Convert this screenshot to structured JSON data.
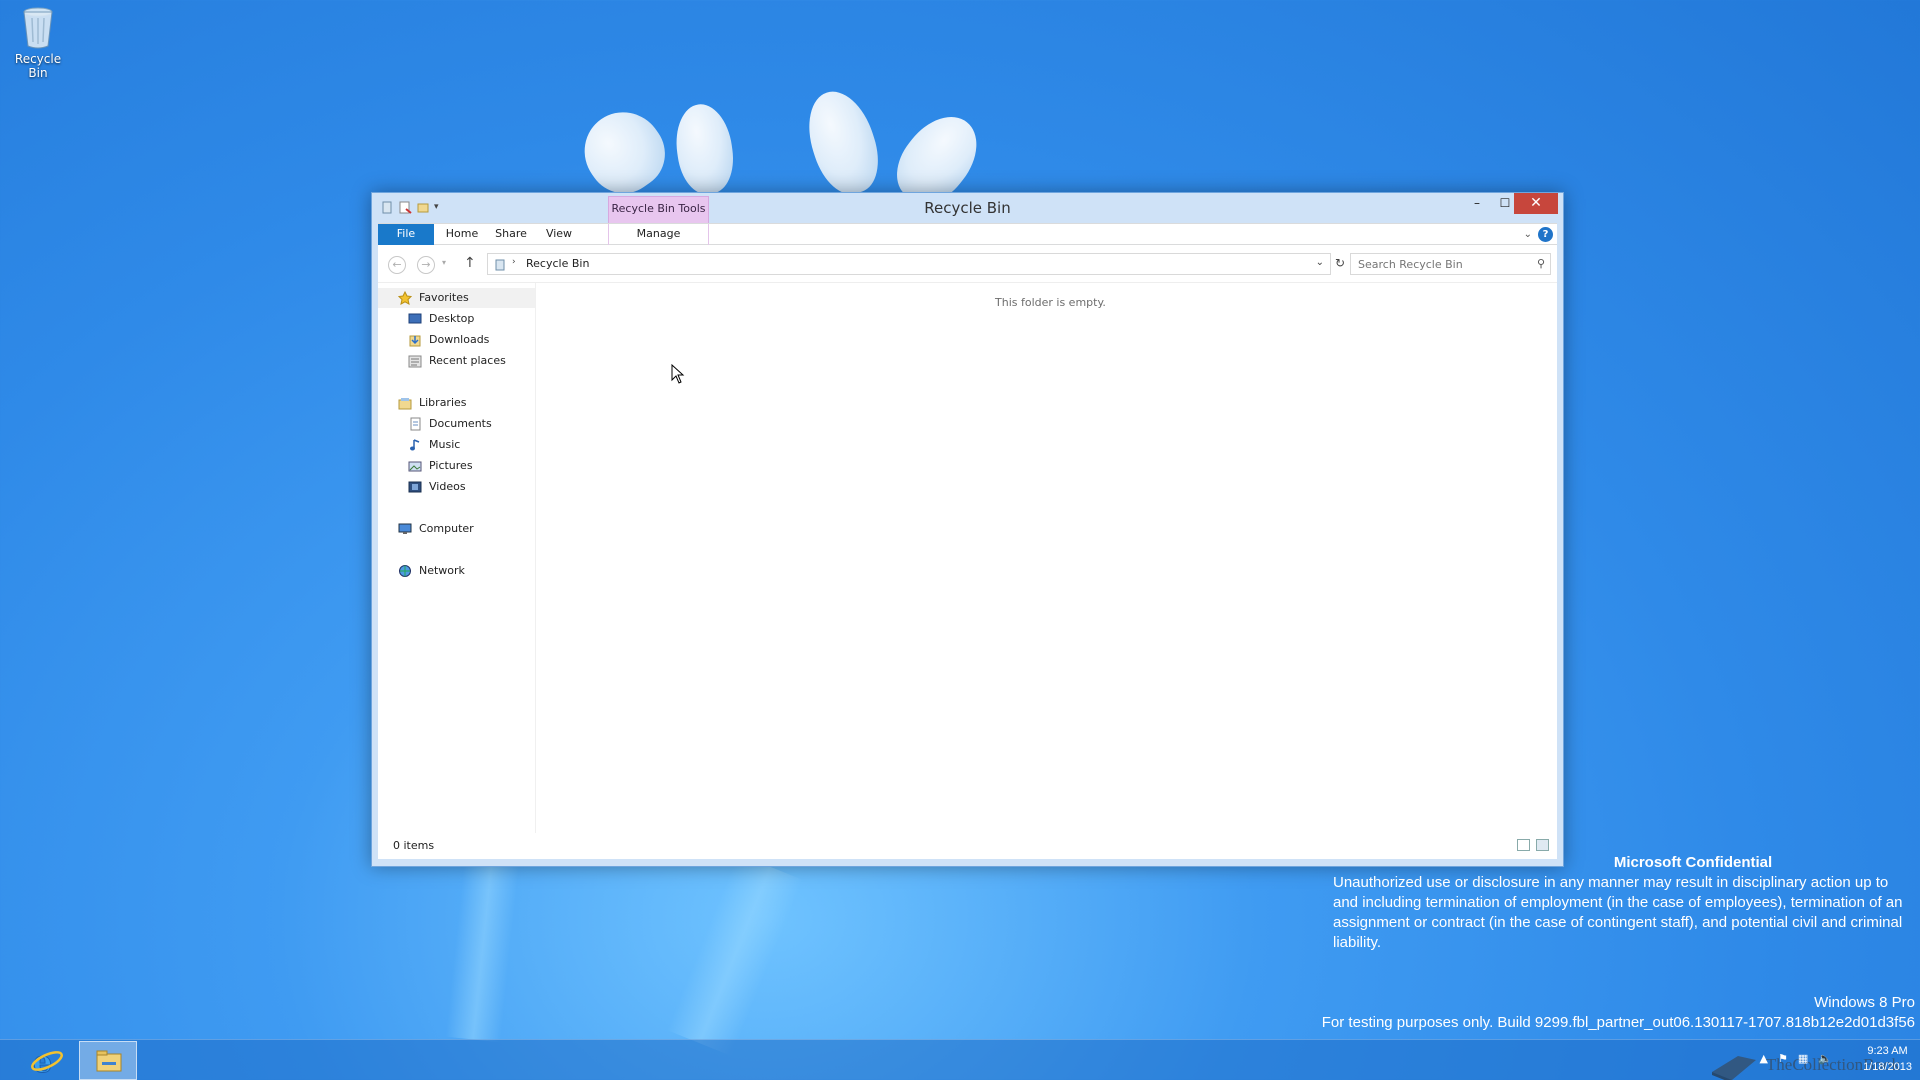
{
  "desktop": {
    "recycle_bin_label": "Recycle Bin"
  },
  "window": {
    "title": "Recycle Bin",
    "contextual_tab": "Recycle Bin Tools",
    "controls": {
      "minimize": "–",
      "maximize": "☐",
      "close": "✕"
    },
    "ribbon_tabs": [
      "File",
      "Home",
      "Share",
      "View",
      "Manage"
    ],
    "address": {
      "location": "Recycle Bin"
    },
    "search": {
      "placeholder": "Search Recycle Bin"
    },
    "empty_message": "This folder is empty.",
    "status": {
      "item_count": "0 items"
    }
  },
  "nav_pane": {
    "favorites": {
      "label": "Favorites",
      "items": [
        "Desktop",
        "Downloads",
        "Recent places"
      ]
    },
    "libraries": {
      "label": "Libraries",
      "items": [
        "Documents",
        "Music",
        "Pictures",
        "Videos"
      ]
    },
    "computer": "Computer",
    "network": "Network"
  },
  "watermark": {
    "heading": "Microsoft Confidential",
    "body": "Unauthorized use or disclosure in any manner may result in disciplinary action up to and including termination of employment (in the case of employees), termination of an assignment or contract (in the case of contingent staff), and potential civil and criminal liability.",
    "edition": "Windows 8 Pro",
    "build": "For testing purposes only. Build 9299.fbl_partner_out06.130117-1707.818b12e2d01d3f56"
  },
  "taskbar": {
    "time": "9:23 AM",
    "date": "1/18/2013",
    "brand_text": "TheCollectionBook"
  },
  "colors": {
    "file_tab": "#1979ca",
    "contextual_tab": "#e8c6ef",
    "close_button": "#c7463c",
    "desktop": "#2f8ae8"
  }
}
